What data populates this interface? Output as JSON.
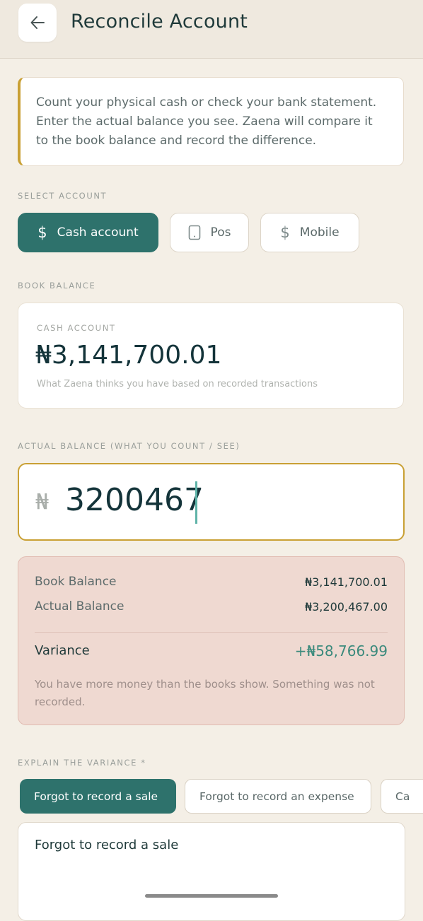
{
  "header": {
    "title": "Reconcile Account"
  },
  "info": {
    "text": "Count your physical cash or check your bank statement. Enter the actual balance you see. Zaena will compare it to the book balance and record the difference."
  },
  "select_account": {
    "label": "SELECT ACCOUNT",
    "options": [
      {
        "label": "Cash account",
        "icon": "dollar-icon",
        "selected": true
      },
      {
        "label": "Pos",
        "icon": "card-reader-icon",
        "selected": false
      },
      {
        "label": "Mobile",
        "icon": "dollar-icon",
        "selected": false
      }
    ]
  },
  "book_balance": {
    "label": "BOOK BALANCE",
    "account_label": "CASH ACCOUNT",
    "amount": "₦3,141,700.01",
    "hint": "What Zaena thinks you have based on recorded transactions"
  },
  "actual_balance": {
    "label": "ACTUAL BALANCE (WHAT YOU COUNT / SEE)",
    "currency": "₦",
    "value": "3200467"
  },
  "comparison": {
    "book_label": "Book Balance",
    "book_value": "₦3,141,700.01",
    "actual_label": "Actual Balance",
    "actual_value": "₦3,200,467.00",
    "variance_label": "Variance",
    "variance_value": "+₦58,766.99",
    "note": "You have more money than the books show. Something was not recorded."
  },
  "explain": {
    "label": "EXPLAIN THE VARIANCE *",
    "reasons": [
      "Forgot to record a sale",
      "Forgot to record an expense",
      "Ca"
    ],
    "text": "Forgot to record a sale"
  },
  "colors": {
    "accent": "#2e726c",
    "highlight": "#c9a034",
    "variance_positive": "#3b8a7c"
  }
}
